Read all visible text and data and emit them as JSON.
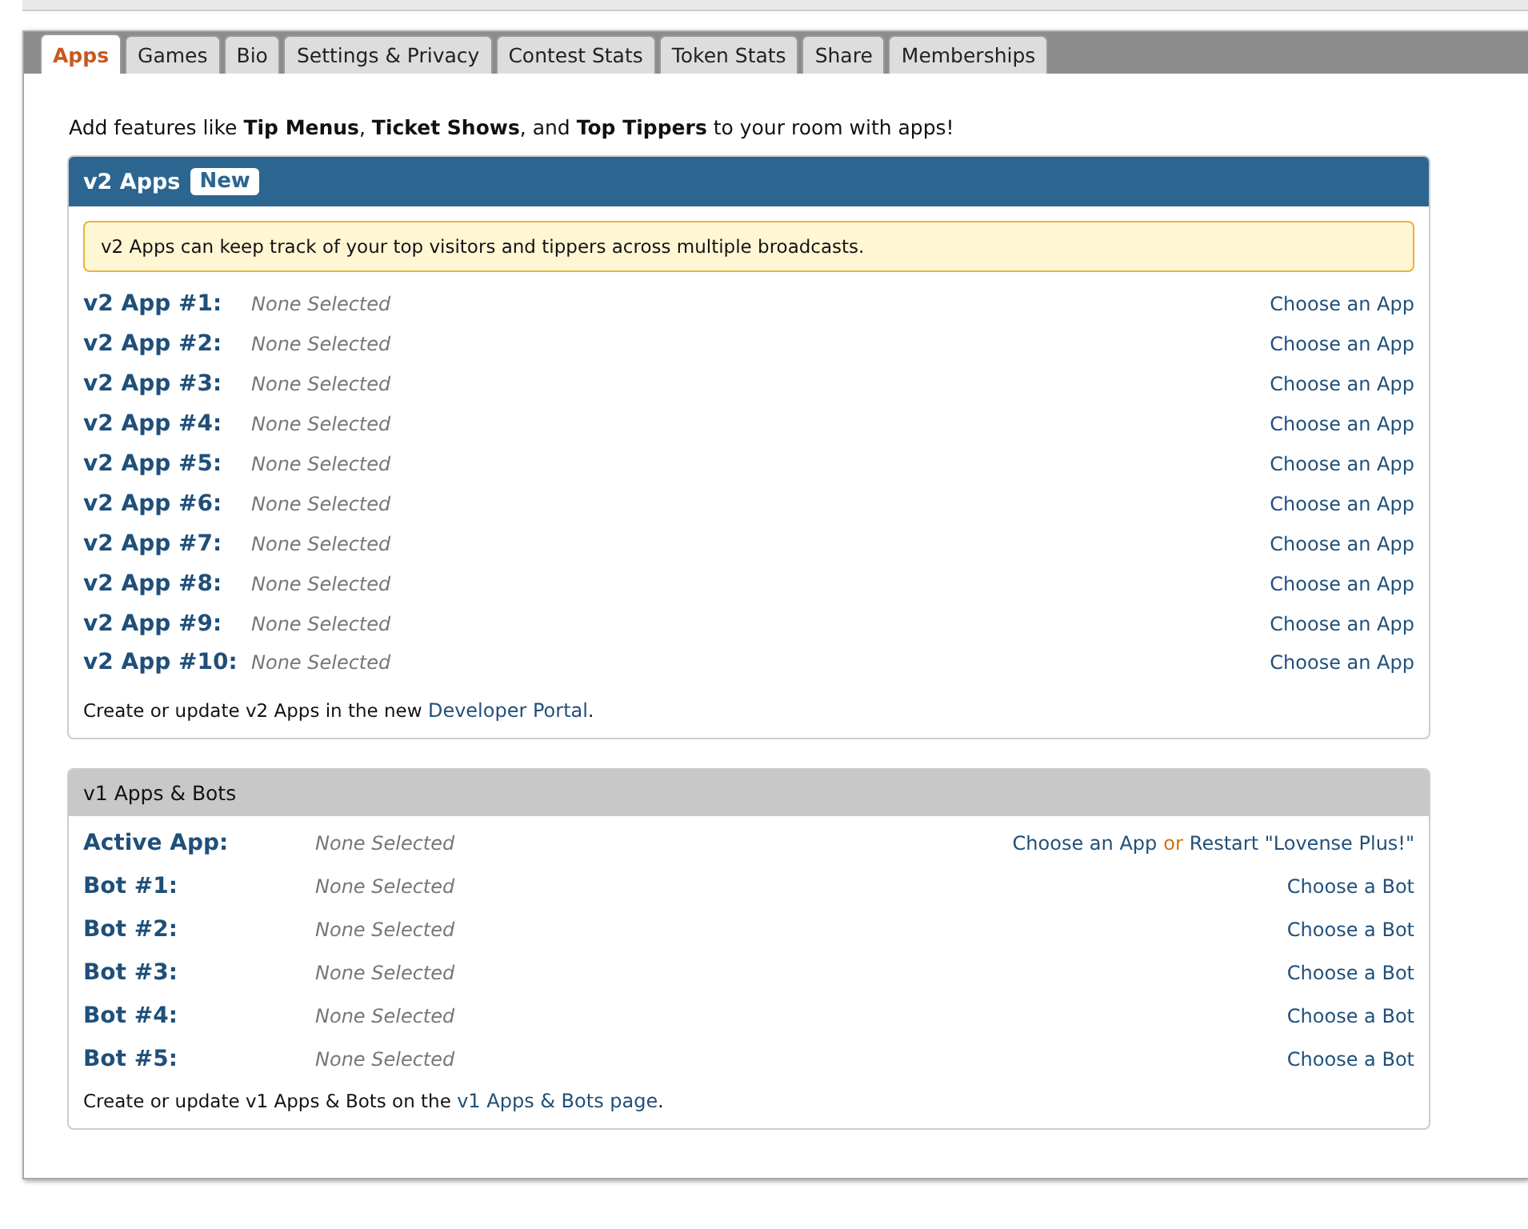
{
  "tabs": [
    {
      "label": "Apps",
      "selected": true
    },
    {
      "label": "Games",
      "selected": false
    },
    {
      "label": "Bio",
      "selected": false
    },
    {
      "label": "Settings & Privacy",
      "selected": false
    },
    {
      "label": "Contest Stats",
      "selected": false
    },
    {
      "label": "Token Stats",
      "selected": false
    },
    {
      "label": "Share",
      "selected": false
    },
    {
      "label": "Memberships",
      "selected": false
    }
  ],
  "intro": "Add features like **Tip Menus**, **Ticket Shows**, and **Top Tippers** to your room with apps!",
  "v2": {
    "title": "v2 Apps",
    "badge": "New",
    "notice": "v2 Apps can keep track of your top visitors and tippers across multiple broadcasts.",
    "slots": [
      {
        "label": "v2 App #1:",
        "value": "None Selected",
        "action": "Choose an App"
      },
      {
        "label": "v2 App #2:",
        "value": "None Selected",
        "action": "Choose an App"
      },
      {
        "label": "v2 App #3:",
        "value": "None Selected",
        "action": "Choose an App"
      },
      {
        "label": "v2 App #4:",
        "value": "None Selected",
        "action": "Choose an App"
      },
      {
        "label": "v2 App #5:",
        "value": "None Selected",
        "action": "Choose an App"
      },
      {
        "label": "v2 App #6:",
        "value": "None Selected",
        "action": "Choose an App"
      },
      {
        "label": "v2 App #7:",
        "value": "None Selected",
        "action": "Choose an App"
      },
      {
        "label": "v2 App #8:",
        "value": "None Selected",
        "action": "Choose an App"
      },
      {
        "label": "v2 App #9:",
        "value": "None Selected",
        "action": "Choose an App"
      },
      {
        "label": "v2 App #10:",
        "value": "None Selected",
        "action": "Choose an App"
      }
    ],
    "footer_text": "Create or update v2 Apps in the new",
    "footer_link": "Developer Portal",
    "footer_end": "."
  },
  "v1": {
    "title": "v1 Apps & Bots",
    "active": {
      "label": "Active App:",
      "value": "None Selected",
      "action": "Choose an App",
      "separator": "or",
      "action2": "Restart \"Lovense Plus!\""
    },
    "slots": [
      {
        "label": "Bot #1:",
        "value": "None Selected",
        "action": "Choose a Bot"
      },
      {
        "label": "Bot #2:",
        "value": "None Selected",
        "action": "Choose a Bot"
      },
      {
        "label": "Bot #3:",
        "value": "None Selected",
        "action": "Choose a Bot"
      },
      {
        "label": "Bot #4:",
        "value": "None Selected",
        "action": "Choose a Bot"
      },
      {
        "label": "Bot #5:",
        "value": "None Selected",
        "action": "Choose a Bot"
      }
    ],
    "footer_text": "Create or update v1 Apps & Bots on the",
    "footer_link": "v1 Apps & Bots page",
    "footer_end": "."
  }
}
